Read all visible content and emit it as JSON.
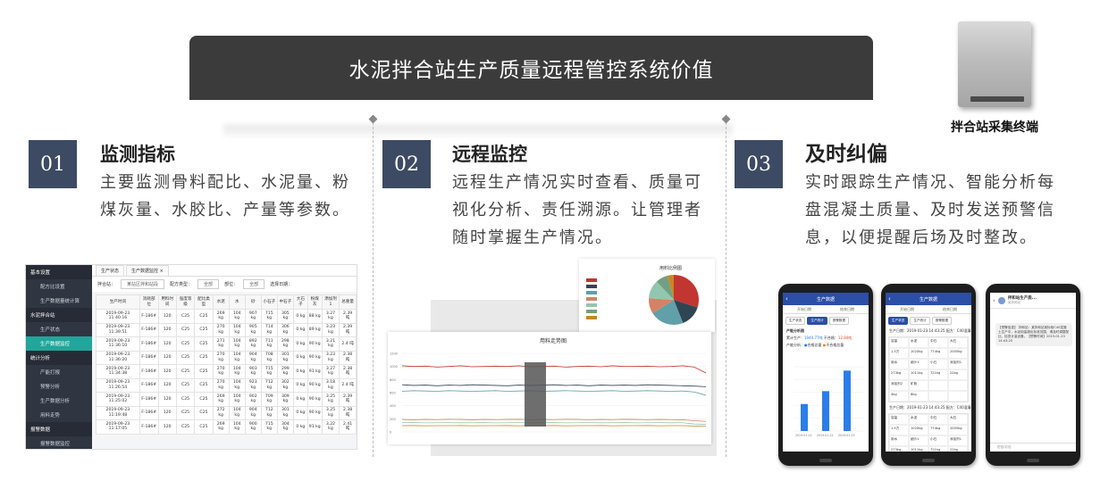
{
  "title": "水泥拌合站生产质量远程管控系统价值",
  "device_label": "拌合站采集终端",
  "sections": [
    {
      "num": "01",
      "title": "监测指标",
      "desc": "主要监测骨料配比、水泥量、粉煤灰量、水胶比、产量等参数。"
    },
    {
      "num": "02",
      "title": "远程监控",
      "desc": "远程生产情况实时查看、质量可视化分析、责任溯源。让管理者随时掌握生产情况。"
    },
    {
      "num": "03",
      "title": "及时纠偏",
      "desc": "实时跟踪生产情况、智能分析每盘混凝土质量、及时发送预警信息，以便提醒后场及时整改。"
    }
  ],
  "screen1": {
    "sidebar": [
      "基本设置",
      "配方比设置",
      "生产数据量统计算",
      "水泥拌合站",
      "生产状态",
      "生产数据监控",
      "统计分析",
      "产能打报",
      "预警分析",
      "生产数据分析",
      "用料走势",
      "报警数据",
      "报警数据监控"
    ],
    "tabs": [
      "生产状态",
      "生产数据监控 ×"
    ],
    "filter": {
      "station_label": "拌合站：",
      "station_value": "某站区拌和站段",
      "type_label": "配方类型：",
      "type_value": "全部",
      "part_label": "部位：",
      "part_value": "全部",
      "date_label": "选择日期："
    },
    "headers": [
      "生产时间",
      "消耗部位",
      "用料时间",
      "强度等级",
      "配比类型",
      "水泥",
      "水",
      "砂",
      "小石子",
      "中石子",
      "大石子",
      "粉煤灰",
      "添加剂1",
      "总重量"
    ],
    "rows": [
      [
        "2019-09-23 11:40:16",
        "F-186#",
        "120",
        "C25",
        "C25",
        "269 kg",
        "104 kg",
        "907 kg",
        "715 kg",
        "305 kg",
        "0 kg",
        "88 kg",
        "3.27 kg",
        "2.39 吨"
      ],
      [
        "2019-09-23 11:39:51",
        "F-186#",
        "120",
        "C25",
        "C25",
        "270 kg",
        "104 kg",
        "905 kg",
        "714 kg",
        "306 kg",
        "0 kg",
        "89 kg",
        "3.23 kg",
        "2.39 吨"
      ],
      [
        "2019-09-23 11:36:10",
        "F-186#",
        "120",
        "C25",
        "C25",
        "271 kg",
        "104 kg",
        "892 kg",
        "711 kg",
        "298 kg",
        "0 kg",
        "90 kg",
        "3.21 kg",
        "2.4 吨"
      ],
      [
        "2019-09-23 11:36:20",
        "F-186#",
        "120",
        "C25",
        "C25",
        "270 kg",
        "104 kg",
        "904 kg",
        "708 kg",
        "301 kg",
        "0 kg",
        "90 kg",
        "3.23 kg",
        "2.38 吨"
      ],
      [
        "2019-09-23 11:34:38",
        "F-186#",
        "120",
        "C25",
        "C25",
        "270 kg",
        "104 kg",
        "903 kg",
        "715 kg",
        "299 kg",
        "0 kg",
        "91 kg",
        "3.27 kg",
        "2.38 吨"
      ],
      [
        "2019-09-23 11:26:54",
        "F-186#",
        "120",
        "C25",
        "C25",
        "270 kg",
        "104 kg",
        "923 kg",
        "712 kg",
        "302 kg",
        "0 kg",
        "90 kg",
        "3.18 kg",
        "2.4 吨"
      ],
      [
        "2019-09-23 11:25:02",
        "F-186#",
        "120",
        "C25",
        "C25",
        "269 kg",
        "104 kg",
        "902 kg",
        "709 kg",
        "309 kg",
        "0 kg",
        "90 kg",
        "3.25 kg",
        "2.39 吨"
      ],
      [
        "2019-09-23 11:19:48",
        "F-186#",
        "120",
        "C25",
        "C25",
        "272 kg",
        "104 kg",
        "904 kg",
        "712 kg",
        "301 kg",
        "0 kg",
        "90 kg",
        "3.25 kg",
        "2.38 吨"
      ],
      [
        "2019-09-23 11:17:05",
        "F-186#",
        "120",
        "C25",
        "C25",
        "269 kg",
        "104 kg",
        "900 kg",
        "715 kg",
        "304 kg",
        "0 kg",
        "91 kg",
        "3.22 kg",
        "2.41 吨"
      ]
    ]
  },
  "pie_chart": {
    "title": "用料比例图",
    "colors": [
      "#c23531",
      "#2f4554",
      "#61a0a8",
      "#d48265",
      "#91c7ae",
      "#749f83",
      "#ca8622"
    ],
    "values": [
      30,
      14,
      22,
      10,
      12,
      8,
      4
    ]
  },
  "chart_data": {
    "type": "line",
    "title": "用料走势图",
    "ylim": [
      0,
      1200
    ],
    "yticks": [
      0,
      200,
      400,
      600,
      800,
      1000,
      1200
    ],
    "series": [
      {
        "color": "#c23531",
        "values": [
          1010,
          1000,
          1005,
          990,
          1000,
          1010,
          995,
          1000,
          1005,
          1000,
          1010,
          995,
          1000,
          1005,
          990,
          1000,
          1005,
          995,
          1010,
          1000,
          1000,
          1005,
          995,
          1000,
          1010,
          990,
          900
        ]
      },
      {
        "color": "#2f4554",
        "values": [
          720,
          710,
          715,
          705,
          715,
          710,
          720,
          715,
          710,
          705,
          715,
          710,
          715,
          720,
          710,
          715,
          705,
          715,
          710,
          715,
          710,
          720,
          715,
          710,
          705,
          700,
          690
        ]
      },
      {
        "color": "#61a0a8",
        "values": [
          620,
          630,
          625,
          620,
          630,
          625,
          620,
          625,
          630,
          620,
          625,
          630,
          620,
          625,
          630,
          625,
          620,
          625,
          630,
          620,
          625,
          630,
          625,
          620,
          625,
          610,
          560
        ]
      },
      {
        "color": "#d48265",
        "values": [
          190,
          185,
          190,
          188,
          192,
          190,
          185,
          190,
          188,
          190,
          192,
          186,
          190,
          188,
          192,
          190,
          186,
          190,
          188,
          192,
          190,
          186,
          190,
          188,
          185,
          170,
          160
        ]
      },
      {
        "color": "#91c7ae",
        "values": [
          140,
          142,
          138,
          140,
          141,
          139,
          140,
          142,
          138,
          140,
          141,
          139,
          140,
          142,
          138,
          140,
          141,
          139,
          140,
          142,
          138,
          140,
          141,
          139,
          140,
          120,
          115
        ]
      },
      {
        "color": "#ca8622",
        "values": [
          95,
          96,
          94,
          95,
          95,
          96,
          94,
          95,
          95,
          96,
          94,
          95,
          95,
          96,
          94,
          95,
          95,
          96,
          94,
          95,
          95,
          96,
          94,
          95,
          95,
          90,
          85
        ]
      }
    ]
  },
  "phone1": {
    "header": "生产数据",
    "tabs": [
      "开始日期",
      "结束日期"
    ],
    "subtabs": [
      "生产状态",
      "生产统计",
      "报警数据"
    ],
    "section": "产能分析图",
    "line1": "累计生产：",
    "value1": "1940.77吨",
    "line2": "不合格：",
    "value2": "12.84吨",
    "line3": "产能分析：",
    "status": "合格总量",
    "status2": "不合格总量",
    "chart_values": [
      210,
      310,
      470
    ],
    "dates": [
      "2019-01-21",
      "2019-01-22",
      "2019-01-23"
    ]
  },
  "phone2": {
    "header": "生产数据",
    "tabs": [
      "开始日期",
      "结束日期"
    ],
    "subtabs": [
      "生产状态",
      "生产统计",
      "报警数据"
    ],
    "line": "生产日期：2019-01-23 14:43:25 配方：C40混凝",
    "grid": [
      "容量",
      "水泥",
      "中石",
      "大石",
      "1.5方",
      "1020kg",
      "774kg",
      "2005kg",
      "用水",
      "细沙1",
      "小石",
      "添加剂1",
      "273kg",
      "1011kg",
      "721kg",
      "22kg",
      "添加剂2",
      "矿粉",
      "",
      "",
      "4kg",
      "8kg",
      "",
      ""
    ],
    "line2": "生产日期：2019-01-23 14:43:25 配方：C40混凝",
    "grid2": [
      "容量",
      "水泥",
      "中石",
      "大石",
      "1.5方",
      "1020kg",
      "774kg",
      "2005kg",
      "用水",
      "细沙1",
      "小石",
      "添加剂1",
      "273kg",
      "1011kg",
      "721kg",
      "22kg",
      "添加剂2",
      "矿粉",
      "",
      "",
      "4kg",
      "8kg",
      "",
      ""
    ]
  },
  "phone3": {
    "name": "拌和站生产质...",
    "sub": "某拌和站",
    "message": "【预警信息】 拌和站：某拌和站某标段C40混凝土生产中，水泥用量超出标准范围，请及时调整配比，检查计量设备。【预警时间】2019-01-23 14:43:25",
    "footer": "短信/彩信"
  }
}
